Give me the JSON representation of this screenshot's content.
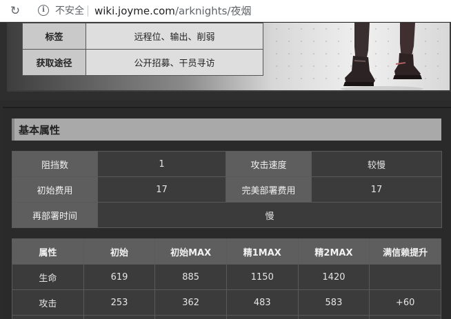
{
  "browser": {
    "security_label": "不安全",
    "url_host": "wiki.joyme.com",
    "url_path": "/arknights/夜烟"
  },
  "operator_info": [
    {
      "key": "标签",
      "value": "远程位、输出、削弱"
    },
    {
      "key": "获取途径",
      "value": "公开招募、干员寻访"
    }
  ],
  "section": {
    "title": "基本属性"
  },
  "basic_attributes": {
    "row1": {
      "k1": "阻挡数",
      "v1": "1",
      "k2": "攻击速度",
      "v2": "较慢"
    },
    "row2": {
      "k1": "初始费用",
      "v1": "17",
      "k2": "完美部署费用",
      "v2": "17"
    },
    "row3": {
      "k1": "再部署时间",
      "v1": "慢"
    }
  },
  "growth_table": {
    "headers": [
      "属性",
      "初始",
      "初始MAX",
      "精1MAX",
      "精2MAX",
      "满信赖提升"
    ],
    "rows": [
      [
        "生命",
        "619",
        "885",
        "1150",
        "1420",
        ""
      ],
      [
        "攻击",
        "253",
        "362",
        "483",
        "583",
        "+60"
      ]
    ]
  }
}
